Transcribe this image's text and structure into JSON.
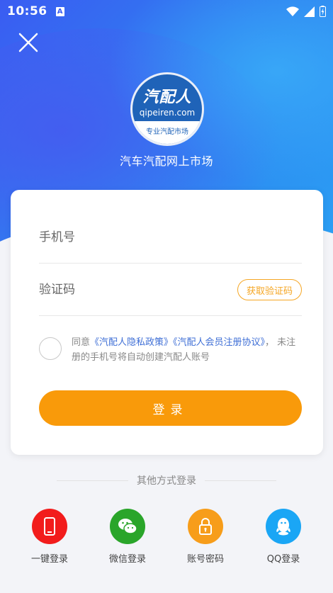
{
  "status_bar": {
    "time": "10:56",
    "badge": "A"
  },
  "header": {
    "logo_cn": "汽配人",
    "logo_en": "qipeiren.com",
    "logo_tag": "专业汽配市场",
    "slogan": "汽车汽配网上市场"
  },
  "form": {
    "phone_placeholder": "手机号",
    "code_placeholder": "验证码",
    "get_code_label": "获取验证码",
    "agree_prefix": "同意",
    "privacy_link": "《汽配人隐私政策》",
    "member_link": "《汽配人会员注册协议》",
    "agree_suffix": "， 未注册的手机号将自动创建汽配人账号",
    "login_label": "登录"
  },
  "other_login": {
    "title": "其他方式登录",
    "methods": [
      {
        "label": "一键登录",
        "icon": "phone-icon",
        "color": "#f21c1c"
      },
      {
        "label": "微信登录",
        "icon": "wechat-icon",
        "color": "#2aa52a"
      },
      {
        "label": "账号密码",
        "icon": "lock-icon",
        "color": "#f79d1a"
      },
      {
        "label": "QQ登录",
        "icon": "qq-icon",
        "color": "#1aa6f5"
      }
    ]
  },
  "colors": {
    "accent": "#f99a0a",
    "link": "#3f6fd6",
    "hero": "#2f7ff0"
  }
}
